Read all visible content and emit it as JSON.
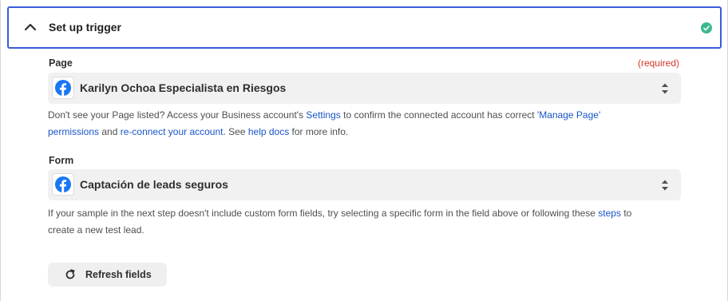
{
  "header": {
    "title": "Set up trigger"
  },
  "page_field": {
    "label": "Page",
    "required": "(required)",
    "value": "Karilyn Ochoa Especialista en Riesgos",
    "help": {
      "t1": "Don't see your Page listed? Access your Business account's ",
      "link_settings": "Settings",
      "t2": " to confirm the connected account has correct ",
      "link_manage_page_1": "'Manage Page'",
      "link_manage_page_2": "permissions",
      "t3": " and ",
      "link_reconnect": "re-connect your account",
      "t4": ". See ",
      "link_help_docs": "help docs",
      "t5": " for more info."
    }
  },
  "form_field": {
    "label": "Form",
    "value": "Captación de leads seguros",
    "help": {
      "t1": "If your sample in the next step doesn't include custom form fields, try selecting a specific form in the field above or following these ",
      "link_steps": "steps",
      "t2": " to",
      "t3": "create a new test lead."
    }
  },
  "refresh_button": {
    "label": "Refresh fields"
  },
  "icons": {
    "collapse": "chevron-up-icon",
    "status": "check-circle-icon",
    "app": "facebook-icon",
    "select": "updown-arrows-icon",
    "refresh": "refresh-icon"
  },
  "colors": {
    "accent_border": "#3b5bdb",
    "success": "#3cb98c",
    "required": "#d0362b",
    "link": "#1a55c9",
    "facebook": "#1877f2"
  }
}
